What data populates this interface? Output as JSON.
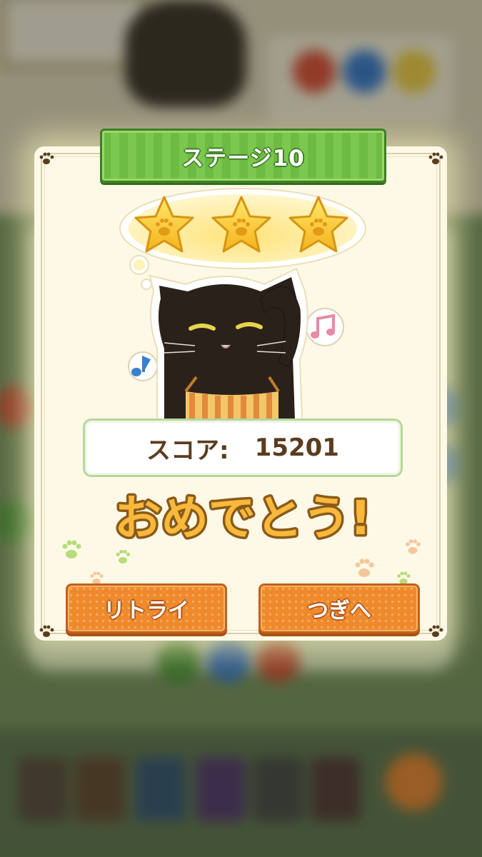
{
  "dialog": {
    "stage_title": "ステージ10",
    "stars_earned": 3,
    "stars_total": 3,
    "score_label": "スコア:",
    "score_value": "15201",
    "congrats_text": "おめでとう!",
    "retry_label": "リトライ",
    "next_label": "つぎへ"
  },
  "colors": {
    "banner_green": "#6dbb42",
    "button_orange": "#ef8a2c",
    "congrats_yellow": "#f8b93a",
    "score_text": "#5a3d1f",
    "dialog_bg": "#fdf9e6"
  }
}
